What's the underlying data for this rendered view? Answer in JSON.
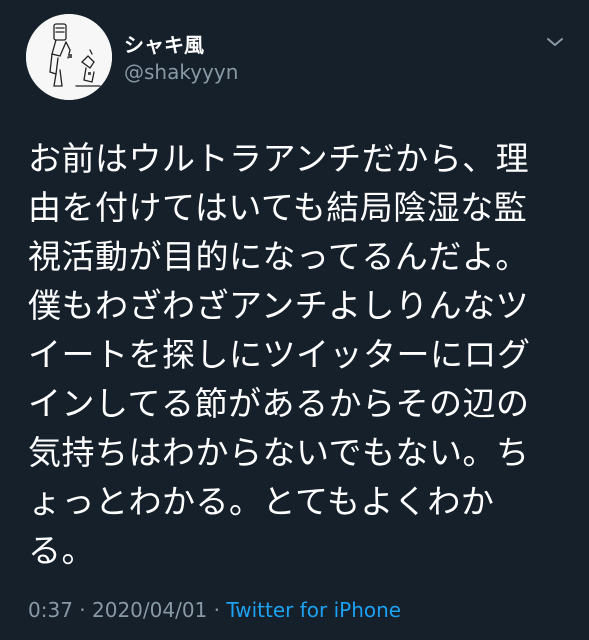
{
  "user": {
    "display_name": "シャキ風",
    "handle": "@shakyyyn"
  },
  "icons": {
    "avatar": "avatar",
    "menu": "chevron-down-icon"
  },
  "tweet": {
    "lines": [
      "お前はウルトラアンチだから、理",
      "由を付けてはいても結局陰湿な監",
      "視活動が目的になってるんだよ。",
      "僕もわざわざアンチよしりんなツ",
      "イートを探しにツイッターにログ",
      "インしてる節があるからその辺の",
      "気持ちはわからないでもない。ち",
      "ょっとわかる。とてもよくわか",
      "る。"
    ]
  },
  "meta": {
    "time": "0:37",
    "sep1": " · ",
    "date": "2020/04/01",
    "sep2": " · ",
    "source": "Twitter for iPhone"
  },
  "colors": {
    "background": "#15202b",
    "text": "#ffffff",
    "secondary": "#8899a6",
    "link": "#1da1f2"
  }
}
